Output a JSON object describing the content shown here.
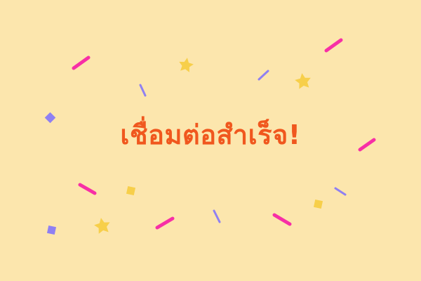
{
  "success": {
    "message": "เชื่อมต่อสำเร็จ!",
    "text_color": "#F0571E",
    "background_color": "#FCE6AD"
  },
  "confetti": {
    "colors": {
      "pink": "#F72FA6",
      "purple": "#8F80F2",
      "gold": "#F7CF4A"
    },
    "icons": [
      "star-icon",
      "confetti-streamer",
      "confetti-square"
    ]
  }
}
